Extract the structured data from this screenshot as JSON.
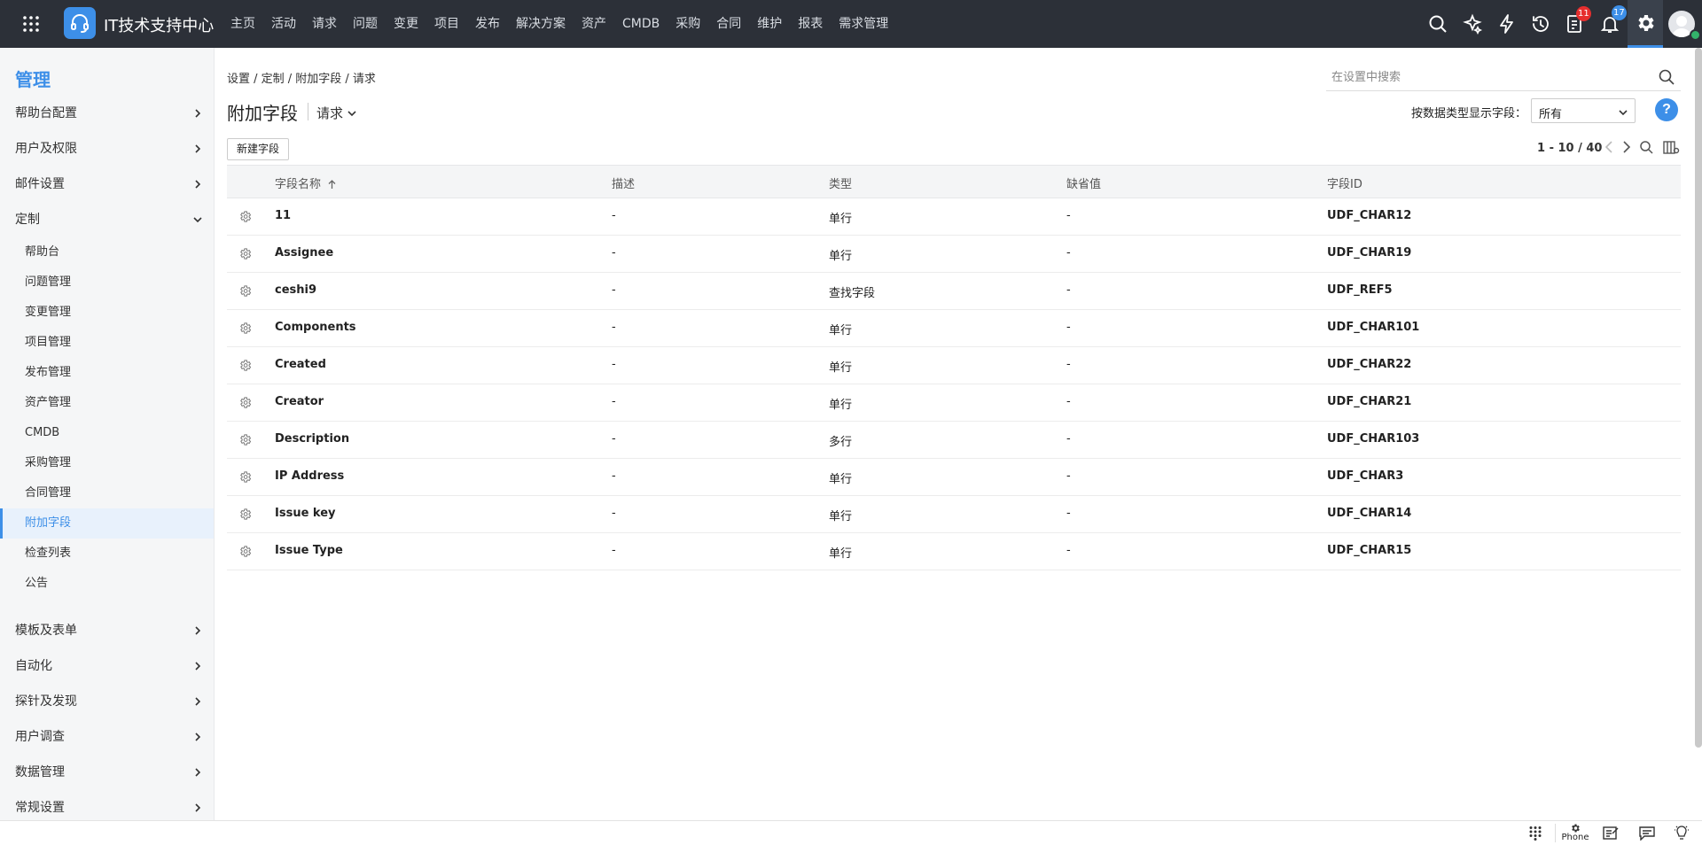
{
  "app": {
    "title": "IT技术支持中心"
  },
  "nav": [
    "主页",
    "活动",
    "请求",
    "问题",
    "变更",
    "项目",
    "发布",
    "解决方案",
    "资产",
    "CMDB",
    "采购",
    "合同",
    "维护",
    "报表",
    "需求管理"
  ],
  "topbar": {
    "badges": {
      "tasks": "11",
      "notifications": "17"
    },
    "colors": {
      "tasks_badge": "#e62e2e",
      "notif_badge": "#3d8fe8",
      "accent": "#3d8fe8"
    }
  },
  "sidebar": {
    "title": "管理",
    "groups_top": [
      {
        "label": "帮助台配置"
      },
      {
        "label": "用户及权限"
      },
      {
        "label": "邮件设置"
      },
      {
        "label": "定制"
      }
    ],
    "sub_items": [
      "帮助台",
      "问题管理",
      "变更管理",
      "项目管理",
      "发布管理",
      "资产管理",
      "CMDB",
      "采购管理",
      "合同管理",
      "附加字段",
      "检查列表",
      "公告"
    ],
    "active_sub": "附加字段",
    "groups_bottom": [
      {
        "label": "模板及表单"
      },
      {
        "label": "自动化"
      },
      {
        "label": "探针及发现"
      },
      {
        "label": "用户调查"
      },
      {
        "label": "数据管理"
      },
      {
        "label": "常规设置"
      }
    ]
  },
  "breadcrumb": "设置 / 定制 / 附加字段 / 请求",
  "search": {
    "placeholder": "在设置中搜索"
  },
  "page": {
    "title": "附加字段",
    "module": "请求",
    "filter_label": "按数据类型显示字段：",
    "filter_value": "所有",
    "help": "?",
    "new_button": "新建字段",
    "pager": "1 - 10 / 40"
  },
  "table": {
    "headers": {
      "name": "字段名称",
      "desc": "描述",
      "type": "类型",
      "default": "缺省值",
      "id": "字段ID"
    },
    "rows": [
      {
        "name": "11",
        "desc": "-",
        "type": "单行",
        "default": "-",
        "id": "UDF_CHAR12"
      },
      {
        "name": "Assignee",
        "desc": "-",
        "type": "单行",
        "default": "-",
        "id": "UDF_CHAR19"
      },
      {
        "name": "ceshi9",
        "desc": "-",
        "type": "查找字段",
        "default": "-",
        "id": "UDF_REF5"
      },
      {
        "name": "Components",
        "desc": "-",
        "type": "单行",
        "default": "-",
        "id": "UDF_CHAR101"
      },
      {
        "name": "Created",
        "desc": "-",
        "type": "单行",
        "default": "-",
        "id": "UDF_CHAR22"
      },
      {
        "name": "Creator",
        "desc": "-",
        "type": "单行",
        "default": "-",
        "id": "UDF_CHAR21"
      },
      {
        "name": "Description",
        "desc": "-",
        "type": "多行",
        "default": "-",
        "id": "UDF_CHAR103"
      },
      {
        "name": "IP Address",
        "desc": "-",
        "type": "单行",
        "default": "-",
        "id": "UDF_CHAR3"
      },
      {
        "name": "Issue key",
        "desc": "-",
        "type": "单行",
        "default": "-",
        "id": "UDF_CHAR14"
      },
      {
        "name": "Issue Type",
        "desc": "-",
        "type": "单行",
        "default": "-",
        "id": "UDF_CHAR15"
      }
    ]
  },
  "bottombar": {
    "phone_label": "Phone"
  }
}
